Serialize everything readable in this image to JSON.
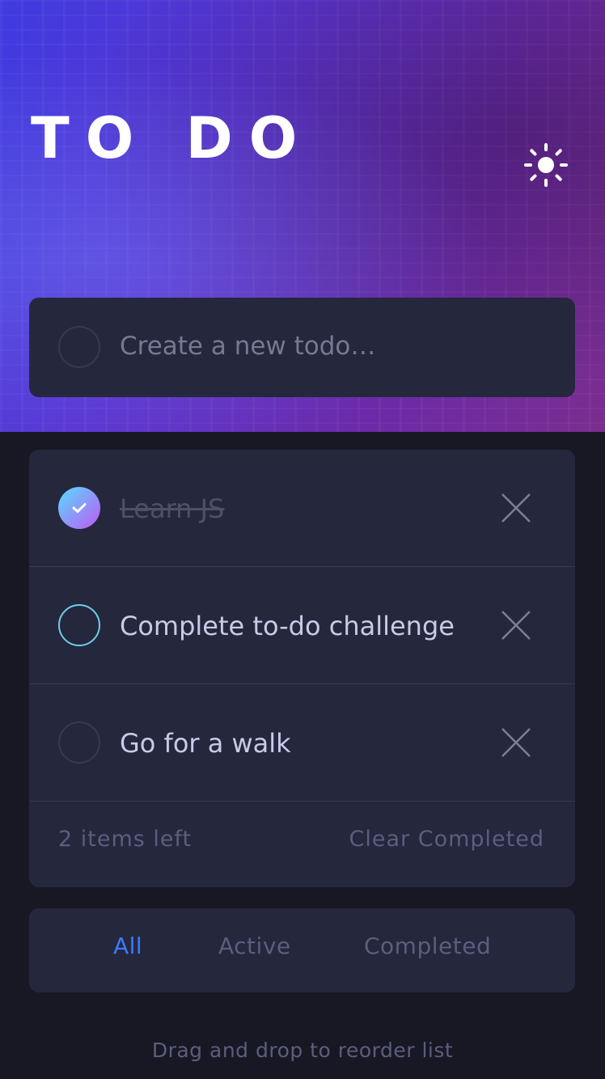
{
  "app": {
    "title": "TO DO",
    "theme_icon": "sun-icon"
  },
  "new_todo": {
    "placeholder": "Create a new todo…"
  },
  "todos": [
    {
      "text": "Learn JS",
      "completed": true
    },
    {
      "text": "Complete to-do challenge",
      "completed": false
    },
    {
      "text": "Go for a walk",
      "completed": false
    }
  ],
  "footer": {
    "items_left": "2 items left",
    "clear_label": "Clear Completed"
  },
  "filters": {
    "all": "All",
    "active": "Active",
    "completed": "Completed",
    "selected": "All"
  },
  "hint": "Drag and drop to reorder list",
  "colors": {
    "background": "#171823",
    "card": "#25273d",
    "active_filter": "#3a7cfd",
    "check_gradient_start": "#55ddff",
    "check_gradient_end": "#c058f3"
  }
}
